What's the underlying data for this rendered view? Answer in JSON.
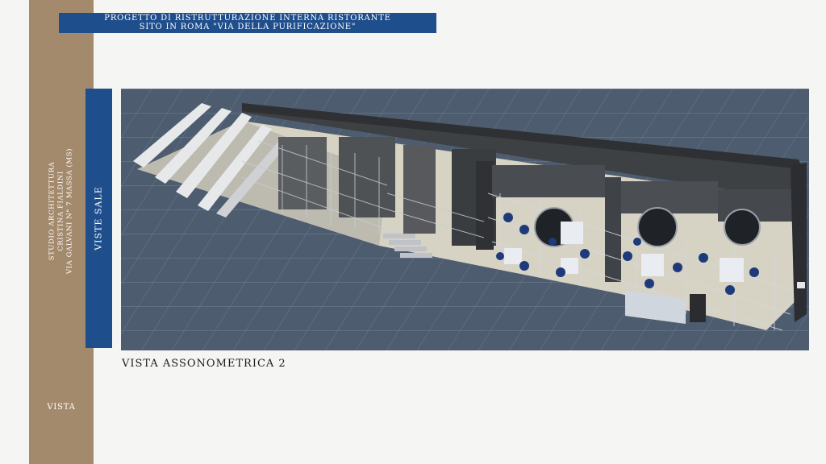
{
  "header": {
    "line1": "PROGETTO DI RISTRUTTURAZIONE INTERNA  RISTORANTE",
    "line2": "SITO IN ROMA \"VIA DELLA PURIFICAZIONE\""
  },
  "sidebar": {
    "studio_line1": "STUDIO ARCHITETTURA",
    "studio_line2": "CRISTINA FIALDINI",
    "studio_line3": "VIA GALVANI N° 7 MASSA (MS)",
    "section_label": "VISTA"
  },
  "panel": {
    "vertical_label": "VISTE SALE",
    "caption": "VISTA ASSONOMETRICA 2"
  },
  "colors": {
    "brand_blue": "#1f4e8c",
    "side_band": "#a48a6c",
    "page_background": "#f5f6f4",
    "render_background": "#4a596b"
  }
}
